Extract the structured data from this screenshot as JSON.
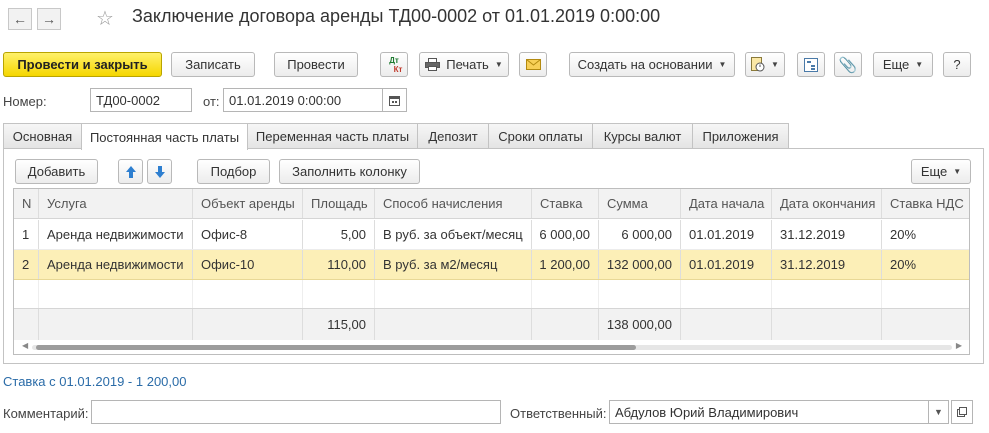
{
  "window": {
    "title": "Заключение договора аренды ТД00-0002 от 01.01.2019 0:00:00"
  },
  "toolbar": {
    "post_and_close": "Провести и закрыть",
    "save": "Записать",
    "post": "Провести",
    "dt_kt_top": "Дт",
    "dt_kt_bottom": "Кт",
    "print": "Печать",
    "create_based_on": "Создать на основании",
    "more": "Еще",
    "help": "?"
  },
  "header": {
    "number_label": "Номер:",
    "number_value": "ТД00-0002",
    "date_label": "от:",
    "date_value": "01.01.2019  0:00:00"
  },
  "tabs": [
    {
      "label": "Основная"
    },
    {
      "label": "Постоянная часть платы"
    },
    {
      "label": "Переменная часть платы"
    },
    {
      "label": "Депозит"
    },
    {
      "label": "Сроки оплаты"
    },
    {
      "label": "Курсы валют"
    },
    {
      "label": "Приложения"
    }
  ],
  "panel_toolbar": {
    "add": "Добавить",
    "selection": "Подбор",
    "fill_column": "Заполнить колонку",
    "more": "Еще"
  },
  "table": {
    "columns": [
      "N",
      "Услуга",
      "Объект аренды",
      "Площадь",
      "Способ начисления",
      "Ставка",
      "Сумма",
      "Дата начала",
      "Дата окончания",
      "Ставка НДС"
    ],
    "rows": [
      [
        "1",
        "Аренда недвижимости",
        "Офис-8",
        "5,00",
        "В руб. за объект/месяц",
        "6 000,00",
        "6 000,00",
        "01.01.2019",
        "31.12.2019",
        "20%"
      ],
      [
        "2",
        "Аренда недвижимости",
        "Офис-10",
        "110,00",
        "В руб. за м2/месяц",
        "1 200,00",
        "132 000,00",
        "01.01.2019",
        "31.12.2019",
        "20%"
      ]
    ],
    "totals": {
      "area": "115,00",
      "sum": "138 000,00"
    }
  },
  "rate_info": "Ставка  с 01.01.2019 - 1 200,00",
  "footer": {
    "comment_label": "Комментарий:",
    "comment_value": "",
    "responsible_label": "Ответственный:",
    "responsible_value": "Абдулов Юрий Владимирович"
  },
  "colors": {
    "primary_button": "#f5d600",
    "selected_row": "#fcefb7",
    "link": "#2b6ca8"
  }
}
